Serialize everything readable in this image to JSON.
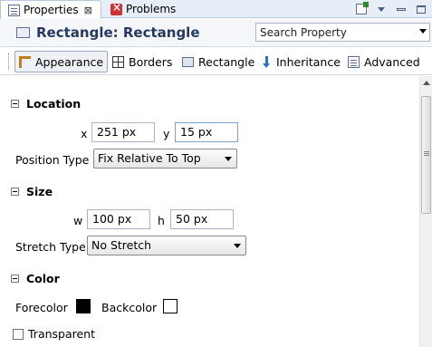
{
  "tabs": {
    "properties": {
      "label": "Properties",
      "close": "⊠"
    },
    "problems": {
      "label": "Problems"
    }
  },
  "header": {
    "title": "Rectangle: Rectangle",
    "search_placeholder": "Search Property"
  },
  "subtabs": [
    {
      "label": "Appearance",
      "active": true
    },
    {
      "label": "Borders"
    },
    {
      "label": "Rectangle"
    },
    {
      "label": "Inheritance"
    },
    {
      "label": "Advanced"
    }
  ],
  "sections": {
    "location": {
      "title": "Location",
      "x_label": "x",
      "x_value": "251 px",
      "y_label": "y",
      "y_value": "15 px",
      "position_type_label": "Position Type",
      "position_type_value": "Fix Relative To Top"
    },
    "size": {
      "title": "Size",
      "w_label": "w",
      "w_value": "100 px",
      "h_label": "h",
      "h_value": "50 px",
      "stretch_type_label": "Stretch Type",
      "stretch_type_value": "No Stretch"
    },
    "color": {
      "title": "Color",
      "forecolor_label": "Forecolor",
      "forecolor": "#000000",
      "backcolor_label": "Backcolor",
      "backcolor": "#ffffff",
      "transparent_label": "Transparent",
      "transparent_checked": false
    }
  },
  "colors": {
    "title_text": "#253a5e",
    "tab_bar_bg": "#e8eef7"
  }
}
